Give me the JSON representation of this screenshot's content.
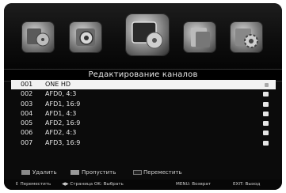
{
  "menu": {
    "items": [
      {
        "name": "media",
        "icon": "media-player-icon"
      },
      {
        "name": "settings",
        "icon": "dial-icon"
      },
      {
        "name": "channels",
        "icon": "tv-channels-icon"
      },
      {
        "name": "time",
        "icon": "calendar-clock-icon"
      },
      {
        "name": "system",
        "icon": "gear-icon"
      }
    ],
    "selected": "channels"
  },
  "title": "Редактирование каналов",
  "channels": [
    {
      "num": "001",
      "name": "ONE HD",
      "selected": true
    },
    {
      "num": "002",
      "name": "AFD0, 4:3",
      "selected": false
    },
    {
      "num": "003",
      "name": "AFD1, 16:9",
      "selected": false
    },
    {
      "num": "004",
      "name": "AFD1, 4:3",
      "selected": false
    },
    {
      "num": "005",
      "name": "AFD2, 16:9",
      "selected": false
    },
    {
      "num": "006",
      "name": "AFD2, 4:3",
      "selected": false
    },
    {
      "num": "007",
      "name": "AFD3, 16:9",
      "selected": false
    }
  ],
  "legend": {
    "delete": "Удалить",
    "skip": "Пропустить",
    "move": "Переместить"
  },
  "hints": {
    "move": "Переместить",
    "page_select": "Страница OK: Выбрать",
    "menu_back": "MENU: Возврат",
    "exit": "EXIT: Выход"
  }
}
